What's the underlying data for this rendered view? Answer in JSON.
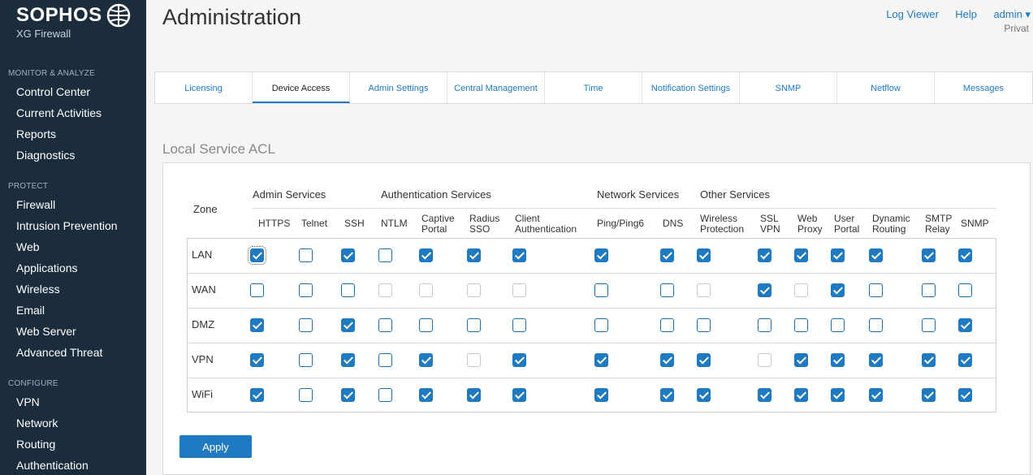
{
  "brand": {
    "name": "SOPHOS",
    "subtitle": "XG Firewall",
    "logo_icon": "sophos-globe-icon"
  },
  "sidebar": {
    "sections": [
      {
        "label": "MONITOR & ANALYZE",
        "items": [
          "Control Center",
          "Current Activities",
          "Reports",
          "Diagnostics"
        ]
      },
      {
        "label": "PROTECT",
        "items": [
          "Firewall",
          "Intrusion Prevention",
          "Web",
          "Applications",
          "Wireless",
          "Email",
          "Web Server",
          "Advanced Threat"
        ]
      },
      {
        "label": "CONFIGURE",
        "items": [
          "VPN",
          "Network",
          "Routing",
          "Authentication"
        ]
      }
    ]
  },
  "header": {
    "title": "Administration",
    "links": {
      "log_viewer": "Log Viewer",
      "help": "Help",
      "user": "admin ▾"
    },
    "sub": "Privat"
  },
  "tabs": [
    "Licensing",
    "Device Access",
    "Admin Settings",
    "Central Management",
    "Time",
    "Notification Settings",
    "SNMP",
    "Netflow",
    "Messages"
  ],
  "active_tab": "Device Access",
  "section_title": "Local Service ACL",
  "acl": {
    "zone_header": "Zone",
    "groups": [
      "Admin Services",
      "Authentication Services",
      "Network Services",
      "Other Services"
    ],
    "columns": [
      {
        "l1": "HTTPS",
        "l2": ""
      },
      {
        "l1": "Telnet",
        "l2": ""
      },
      {
        "l1": "SSH",
        "l2": ""
      },
      {
        "l1": "NTLM",
        "l2": ""
      },
      {
        "l1": "Captive",
        "l2": "Portal"
      },
      {
        "l1": "Radius",
        "l2": "SSO"
      },
      {
        "l1": "Client",
        "l2": "Authentication"
      },
      {
        "l1": "Ping/Ping6",
        "l2": ""
      },
      {
        "l1": "DNS",
        "l2": ""
      },
      {
        "l1": "Wireless",
        "l2": "Protection"
      },
      {
        "l1": "SSL",
        "l2": "VPN"
      },
      {
        "l1": "Web",
        "l2": "Proxy"
      },
      {
        "l1": "User",
        "l2": "Portal"
      },
      {
        "l1": "Dynamic",
        "l2": "Routing"
      },
      {
        "l1": "SMTP",
        "l2": "Relay"
      },
      {
        "l1": "SNMP",
        "l2": ""
      }
    ],
    "rows": [
      {
        "zone": "LAN",
        "states": [
          "on",
          "off",
          "on",
          "off",
          "on",
          "on",
          "on",
          "on",
          "on",
          "on",
          "on",
          "on",
          "on",
          "on",
          "on",
          "on"
        ]
      },
      {
        "zone": "WAN",
        "states": [
          "off",
          "off",
          "off",
          "dis",
          "dis",
          "dis",
          "dis",
          "off",
          "off",
          "dis",
          "on",
          "dis",
          "on",
          "off",
          "off",
          "off"
        ]
      },
      {
        "zone": "DMZ",
        "states": [
          "on",
          "off",
          "on",
          "off",
          "off",
          "off",
          "off",
          "off",
          "off",
          "off",
          "off",
          "off",
          "off",
          "off",
          "off",
          "on"
        ]
      },
      {
        "zone": "VPN",
        "states": [
          "on",
          "off",
          "on",
          "off",
          "on",
          "dis",
          "on",
          "on",
          "on",
          "on",
          "dis",
          "on",
          "on",
          "on",
          "on",
          "on"
        ]
      },
      {
        "zone": "WiFi",
        "states": [
          "on",
          "off",
          "on",
          "off",
          "on",
          "on",
          "on",
          "on",
          "on",
          "on",
          "on",
          "on",
          "on",
          "on",
          "on",
          "on"
        ]
      }
    ]
  },
  "apply_label": "Apply",
  "colors": {
    "sidebar_bg": "#1b2d3c",
    "accent": "#1f7ac2"
  }
}
